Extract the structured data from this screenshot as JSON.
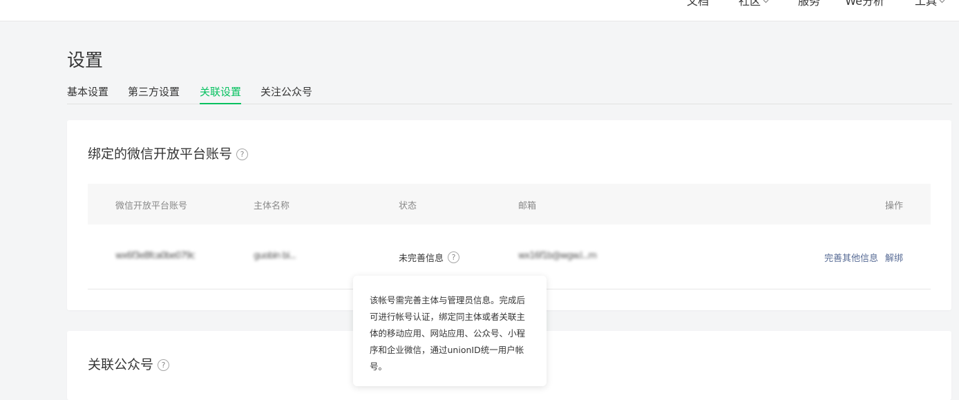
{
  "topnav": {
    "items": [
      {
        "label": "文档"
      },
      {
        "label": "社区"
      },
      {
        "label": "服务"
      },
      {
        "label": "We分析"
      },
      {
        "label": "工具"
      }
    ]
  },
  "page": {
    "title": "设置"
  },
  "tabs": [
    {
      "label": "基本设置"
    },
    {
      "label": "第三方设置"
    },
    {
      "label": "关联设置",
      "active": true
    },
    {
      "label": "关注公众号"
    }
  ],
  "bind_card": {
    "title": "绑定的微信开放平台账号",
    "headers": {
      "account": "微信开放平台账号",
      "entity": "主体名称",
      "status": "状态",
      "email": "邮箱",
      "ops": "操作"
    },
    "row": {
      "account": "wx6f3e8fca0be079c",
      "entity": "guobin  bi...  ",
      "status": "未完善信息",
      "email": "wx16f1b@wgw.l...m",
      "ops": {
        "complete": "完善其他信息",
        "unbind": "解绑"
      }
    }
  },
  "tooltip": {
    "text": "该帐号需完善主体与管理员信息。完成后可进行帐号认证，绑定同主体或者关联主体的移动应用、网站应用、公众号、小程序和企业微信，通过unionID统一用户帐号。"
  },
  "mp_card": {
    "title": "关联公众号"
  },
  "colors": {
    "accent": "#07c160",
    "link": "#576b95",
    "background": "#f4f5f6"
  }
}
